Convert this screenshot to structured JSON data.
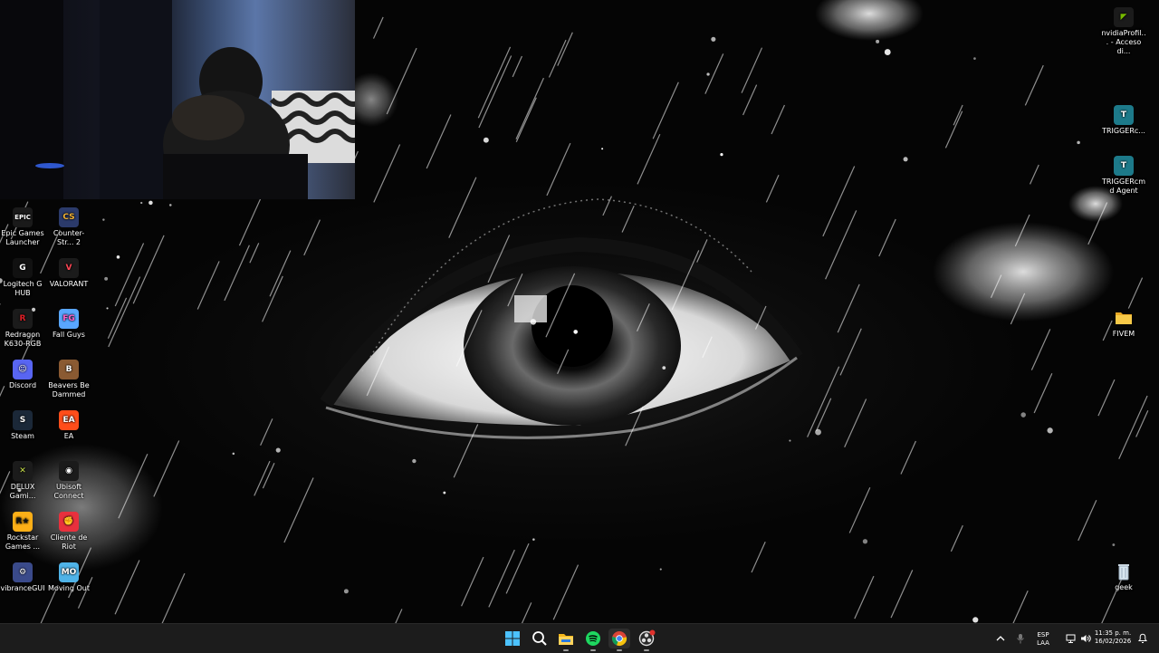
{
  "desktop": {
    "left_icons": [
      {
        "label": "Epic Games Launcher",
        "glyph": "EPIC",
        "color": "#1a1a1a",
        "fg": "#ffffff",
        "icon": "epic-games-icon"
      },
      {
        "label": "Counter-Str... 2",
        "glyph": "CS",
        "color": "#2b3a6a",
        "fg": "#f2b233",
        "icon": "counter-strike-icon"
      },
      {
        "label": "Logitech G HUB",
        "glyph": "G",
        "color": "#111111",
        "fg": "#ffffff",
        "icon": "logitech-ghub-icon"
      },
      {
        "label": "VALORANT",
        "glyph": "V",
        "color": "#1b1b1b",
        "fg": "#ff4655",
        "icon": "valorant-icon"
      },
      {
        "label": "Redragon K630-RGB",
        "glyph": "R",
        "color": "#1b1b1b",
        "fg": "#e01f26",
        "icon": "redragon-icon"
      },
      {
        "label": "Fall Guys",
        "glyph": "FG",
        "color": "#59a6ff",
        "fg": "#ff5fc9",
        "icon": "fall-guys-icon"
      },
      {
        "label": "Discord",
        "glyph": "☺",
        "color": "#5865f2",
        "fg": "#ffffff",
        "icon": "discord-icon"
      },
      {
        "label": "Beavers Be Dammed",
        "glyph": "B",
        "color": "#8a5a32",
        "fg": "#ffffff",
        "icon": "beavers-be-dammed-icon"
      },
      {
        "label": "Steam",
        "glyph": "S",
        "color": "#1b2838",
        "fg": "#ffffff",
        "icon": "steam-icon"
      },
      {
        "label": "EA",
        "glyph": "EA",
        "color": "#ff4d1a",
        "fg": "#ffffff",
        "icon": "ea-icon"
      },
      {
        "label": "DELUX Gami...",
        "glyph": "✕",
        "color": "#1b1b1b",
        "fg": "#c9e04a",
        "icon": "delux-gaming-icon"
      },
      {
        "label": "Ubisoft Connect",
        "glyph": "◉",
        "color": "#1b1b1b",
        "fg": "#ffffff",
        "icon": "ubisoft-connect-icon"
      },
      {
        "label": "Rockstar Games ...",
        "glyph": "R★",
        "color": "#fcaf17",
        "fg": "#111111",
        "icon": "rockstar-games-icon"
      },
      {
        "label": "Cliente de Riot",
        "glyph": "✊",
        "color": "#e8303d",
        "fg": "#ffffff",
        "icon": "riot-client-icon"
      },
      {
        "label": "vibranceGUI",
        "glyph": "⚙",
        "color": "#3a4a8a",
        "fg": "#ffffff",
        "icon": "vibrancegui-icon"
      },
      {
        "label": "Moving Out",
        "glyph": "MO",
        "color": "#4fb3e8",
        "fg": "#ffffff",
        "icon": "moving-out-icon"
      }
    ],
    "right_icons": [
      {
        "label": "nvidiaProfil... - Acceso di...",
        "glyph": "◤",
        "color": "#1b1b1b",
        "fg": "#76b900",
        "icon": "nvidia-profile-icon"
      },
      {
        "label": "TRIGGERc...",
        "glyph": "T",
        "color": "#1d7a8a",
        "fg": "#ffffff",
        "icon": "triggercmd-icon"
      },
      {
        "label": "TRIGGERcmd Agent",
        "glyph": "T",
        "color": "#1d7a8a",
        "fg": "#ffffff",
        "icon": "triggercmd-agent-icon"
      },
      {
        "label": "FIVEM",
        "glyph": "",
        "color": "#f2c14a",
        "fg": "#ffffff",
        "icon": "folder-icon"
      },
      {
        "label": "geek",
        "glyph": "🗑",
        "color": "transparent",
        "fg": "#dddddd",
        "icon": "recycle-bin-icon"
      }
    ]
  },
  "taskbar": {
    "apps": [
      {
        "name": "start-button",
        "icon": "windows-icon"
      },
      {
        "name": "search-button",
        "icon": "search-icon"
      },
      {
        "name": "file-explorer-button",
        "icon": "folder-icon"
      },
      {
        "name": "spotify-button",
        "icon": "spotify-icon"
      },
      {
        "name": "chrome-button",
        "icon": "chrome-icon"
      },
      {
        "name": "obs-button",
        "icon": "obs-icon"
      }
    ],
    "language_line1": "ESP",
    "language_line2": "LAA",
    "time": "11:35 p. m.",
    "date": "16/02/2026"
  }
}
